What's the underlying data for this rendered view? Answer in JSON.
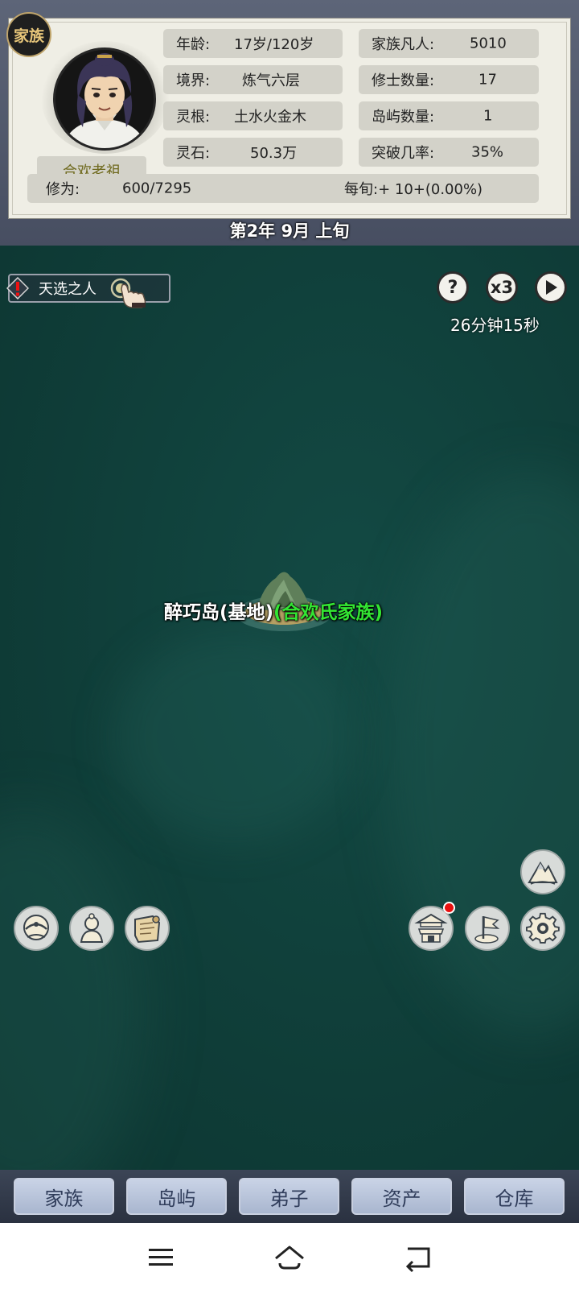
{
  "header": {
    "family_badge": "家族",
    "character_name": "合欢老祖",
    "stats": [
      {
        "label": "年龄:",
        "value": "17岁/120岁"
      },
      {
        "label": "家族凡人:",
        "value": "5010"
      },
      {
        "label": "境界:",
        "value": "炼气六层"
      },
      {
        "label": "修士数量:",
        "value": "17"
      },
      {
        "label": "灵根:",
        "value": "土水火金木"
      },
      {
        "label": "岛屿数量:",
        "value": "1"
      },
      {
        "label": "灵石:",
        "value": "50.3万"
      },
      {
        "label": "突破几率:",
        "value": "35%"
      }
    ],
    "cultivation": {
      "label": "修为:",
      "value": "600/7295",
      "rate": "每旬:+ 10+(0.00%)"
    },
    "date": "第2年 9月 上旬"
  },
  "event": {
    "label": "天选之人"
  },
  "controls": {
    "help": "?",
    "speed": "x3",
    "timer": "26分钟15秒"
  },
  "island": {
    "name": "醉巧岛(基地)",
    "clan": "(合欢氏家族)"
  },
  "tabs": [
    "家族",
    "岛屿",
    "弟子",
    "资产",
    "仓库"
  ],
  "icons": {
    "left_buttons": [
      "clan-hall-icon",
      "disciple-portrait-icon",
      "scroll-map-icon"
    ],
    "right_buttons": [
      "mountain-icon",
      "gate-building-icon",
      "flag-icon",
      "settings-gear-icon"
    ],
    "system_nav": [
      "menu-icon",
      "home-icon",
      "back-icon"
    ]
  },
  "colors": {
    "clan_green": "#33e633",
    "sea": "#0f3c37",
    "notification_red": "#e81010"
  }
}
